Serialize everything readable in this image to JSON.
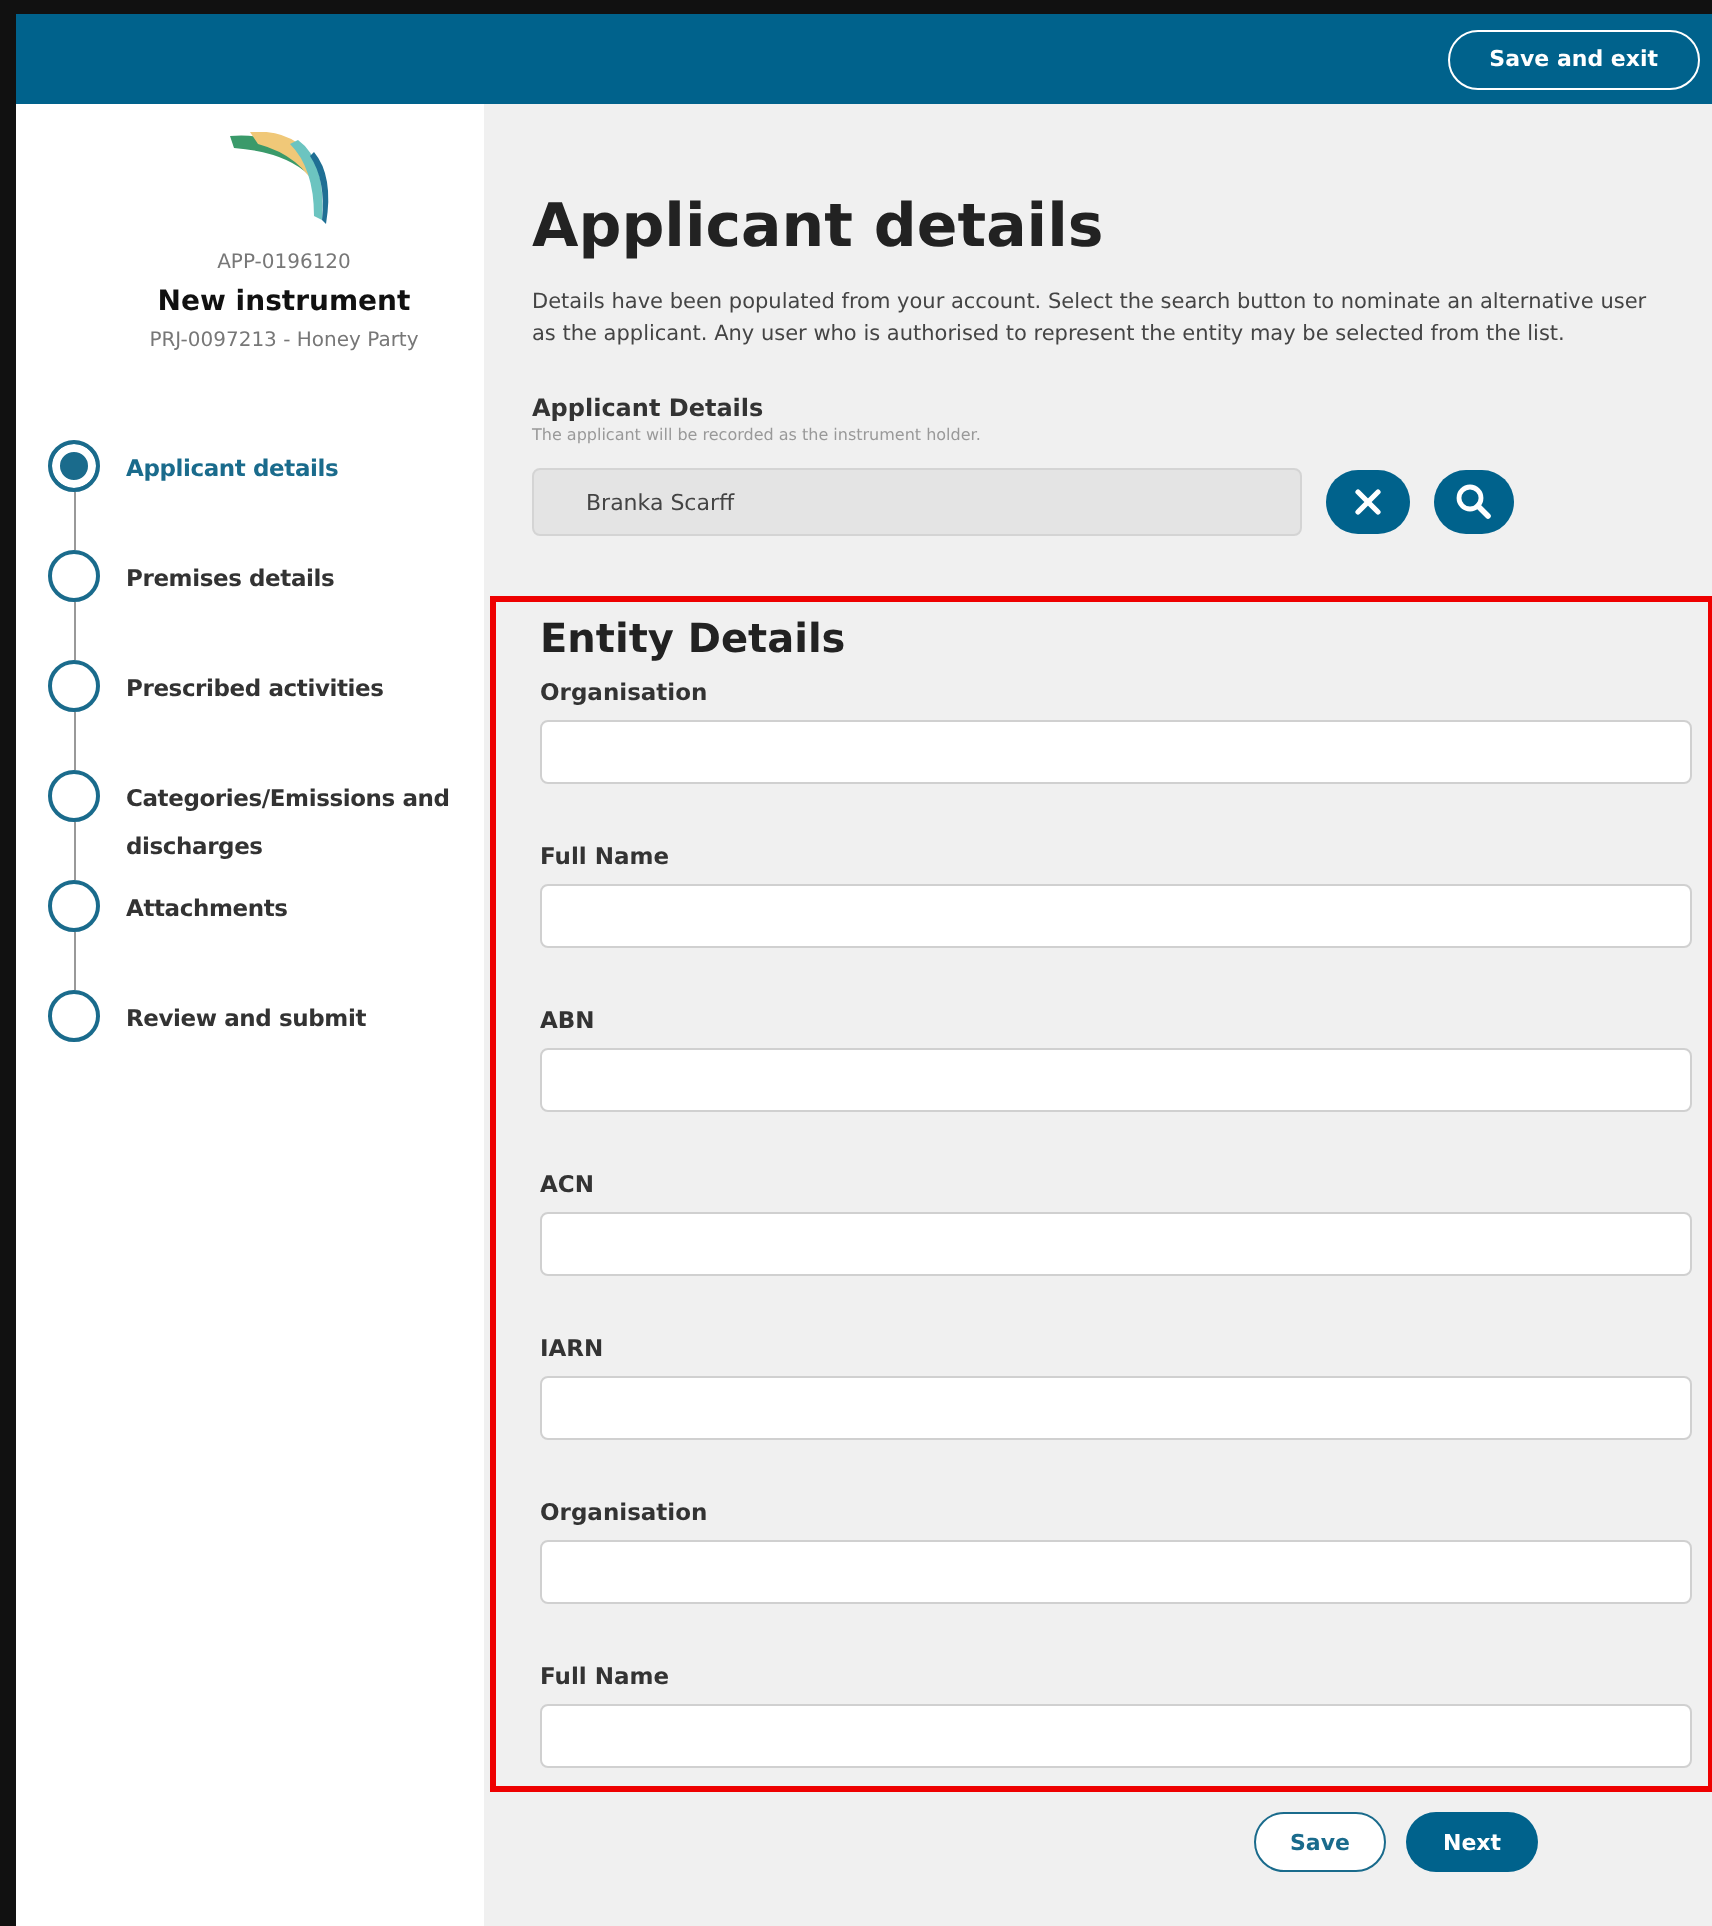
{
  "header": {
    "save_exit": "Save and exit"
  },
  "sidebar": {
    "app_id": "APP-0196120",
    "title": "New instrument",
    "project": "PRJ-0097213 - Honey Party",
    "steps": [
      {
        "label": "Applicant details",
        "selected": true
      },
      {
        "label": "Premises details",
        "selected": false
      },
      {
        "label": "Prescribed activities",
        "selected": false
      },
      {
        "label": "Categories/Emissions and discharges",
        "selected": false
      },
      {
        "label": "Attachments",
        "selected": false
      },
      {
        "label": "Review and submit",
        "selected": false
      }
    ]
  },
  "main": {
    "title": "Applicant details",
    "intro": "Details have been populated from your account. Select the search button to nominate an alternative user as the applicant. Any user who is authorised to represent the entity may be selected from the list.",
    "applicant": {
      "label": "Applicant Details",
      "hint": "The applicant will be recorded as the instrument holder.",
      "value": "Branka Scarff"
    },
    "entity": {
      "title": "Entity Details",
      "fields": [
        {
          "label": "Organisation"
        },
        {
          "label": "Full Name"
        },
        {
          "label": "ABN"
        },
        {
          "label": "ACN"
        },
        {
          "label": "IARN"
        },
        {
          "label": "Organisation"
        },
        {
          "label": "Full Name"
        }
      ]
    },
    "buttons": {
      "save": "Save",
      "next": "Next"
    }
  }
}
